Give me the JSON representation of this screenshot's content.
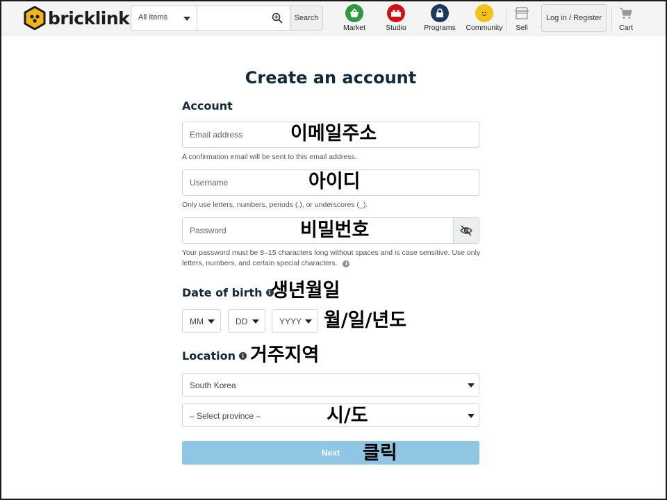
{
  "header": {
    "logo_text": "bricklink",
    "search_category": "All Items",
    "search_button": "Search",
    "nav": [
      {
        "label": "Market",
        "icon": "basket-icon",
        "color": "#2e9a3d"
      },
      {
        "label": "Studio",
        "icon": "brick-icon",
        "color": "#d01012"
      },
      {
        "label": "Programs",
        "icon": "lock-icon",
        "color": "#1b3a5b"
      },
      {
        "label": "Community",
        "icon": "minifig-face-icon",
        "color": "#f2c21a"
      },
      {
        "label": "Sell",
        "icon": "storefront-icon",
        "color": "#888888"
      }
    ],
    "login_label": "Log in / Register",
    "cart_label": "Cart"
  },
  "form": {
    "title": "Create an account",
    "account_heading": "Account",
    "email_placeholder": "Email address",
    "email_hint": "A confirmation email will be sent to this email address.",
    "username_placeholder": "Username",
    "username_hint": "Only use letters, numbers, periods (.), or underscores (_).",
    "password_placeholder": "Password",
    "password_hint": "Your password must be 8–15 characters long without spaces and is case sensitive. Use only letters, numbers, and certain special characters.",
    "dob_heading": "Date of birth",
    "dob_month": "MM",
    "dob_day": "DD",
    "dob_year": "YYYY",
    "location_heading": "Location",
    "country": "South Korea",
    "province": "– Select province –",
    "next_label": "Next"
  },
  "annotations": {
    "email": "이메일주소",
    "username": "아이디",
    "password": "비밀번호",
    "dob": "생년월일",
    "dob_format": "월/일/년도",
    "location": "거주지역",
    "province": "시/도",
    "next": "클릭"
  },
  "colors": {
    "accent_next": "#8fc6e4",
    "title": "#102a3c"
  }
}
